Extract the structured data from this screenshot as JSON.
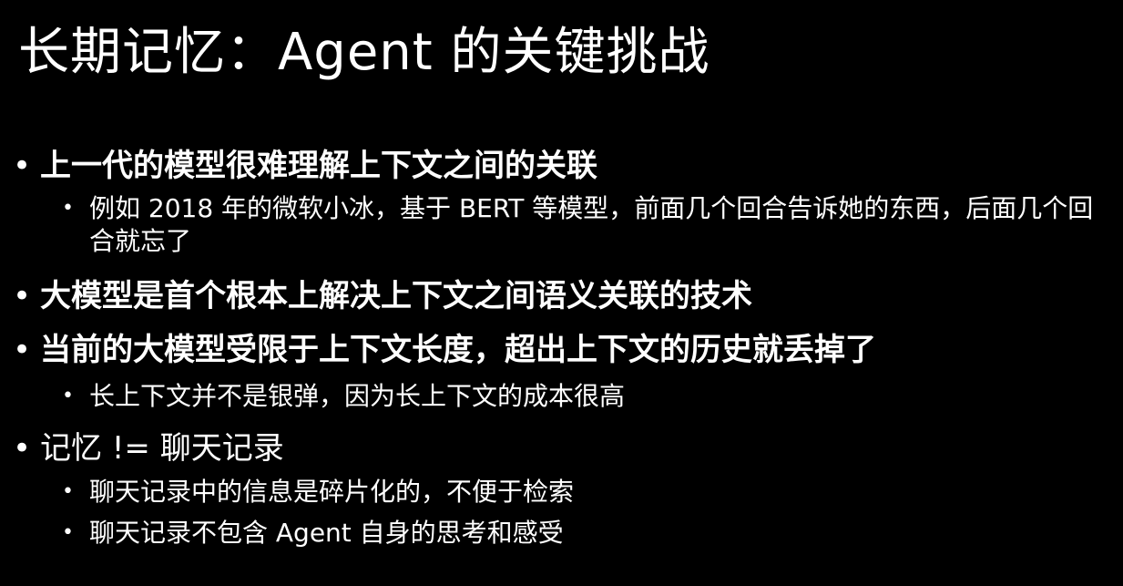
{
  "slide": {
    "title": "长期记忆：Agent 的关键挑战",
    "bullet_symbol": "•",
    "points": [
      {
        "level": 1,
        "bold": true,
        "text": "上一代的模型很难理解上下文之间的关联"
      },
      {
        "level": 2,
        "bold": false,
        "text": "例如 2018 年的微软小冰，基于 BERT 等模型，前面几个回合告诉她的东西，后面几个回合就忘了"
      },
      {
        "level": 1,
        "bold": true,
        "text": "大模型是首个根本上解决上下文之间语义关联的技术"
      },
      {
        "level": 1,
        "bold": true,
        "text": "当前的大模型受限于上下文长度，超出上下文的历史就丢掉了"
      },
      {
        "level": 2,
        "bold": false,
        "text": "长上下文并不是银弹，因为长上下文的成本很高"
      },
      {
        "level": 1,
        "bold": false,
        "text": "记忆 != 聊天记录"
      },
      {
        "level": 2,
        "bold": false,
        "text": "聊天记录中的信息是碎片化的，不便于检索"
      },
      {
        "level": 2,
        "bold": false,
        "text": "聊天记录不包含 Agent 自身的思考和感受"
      }
    ]
  },
  "colors": {
    "background": "#000000",
    "text": "#ffffff"
  }
}
